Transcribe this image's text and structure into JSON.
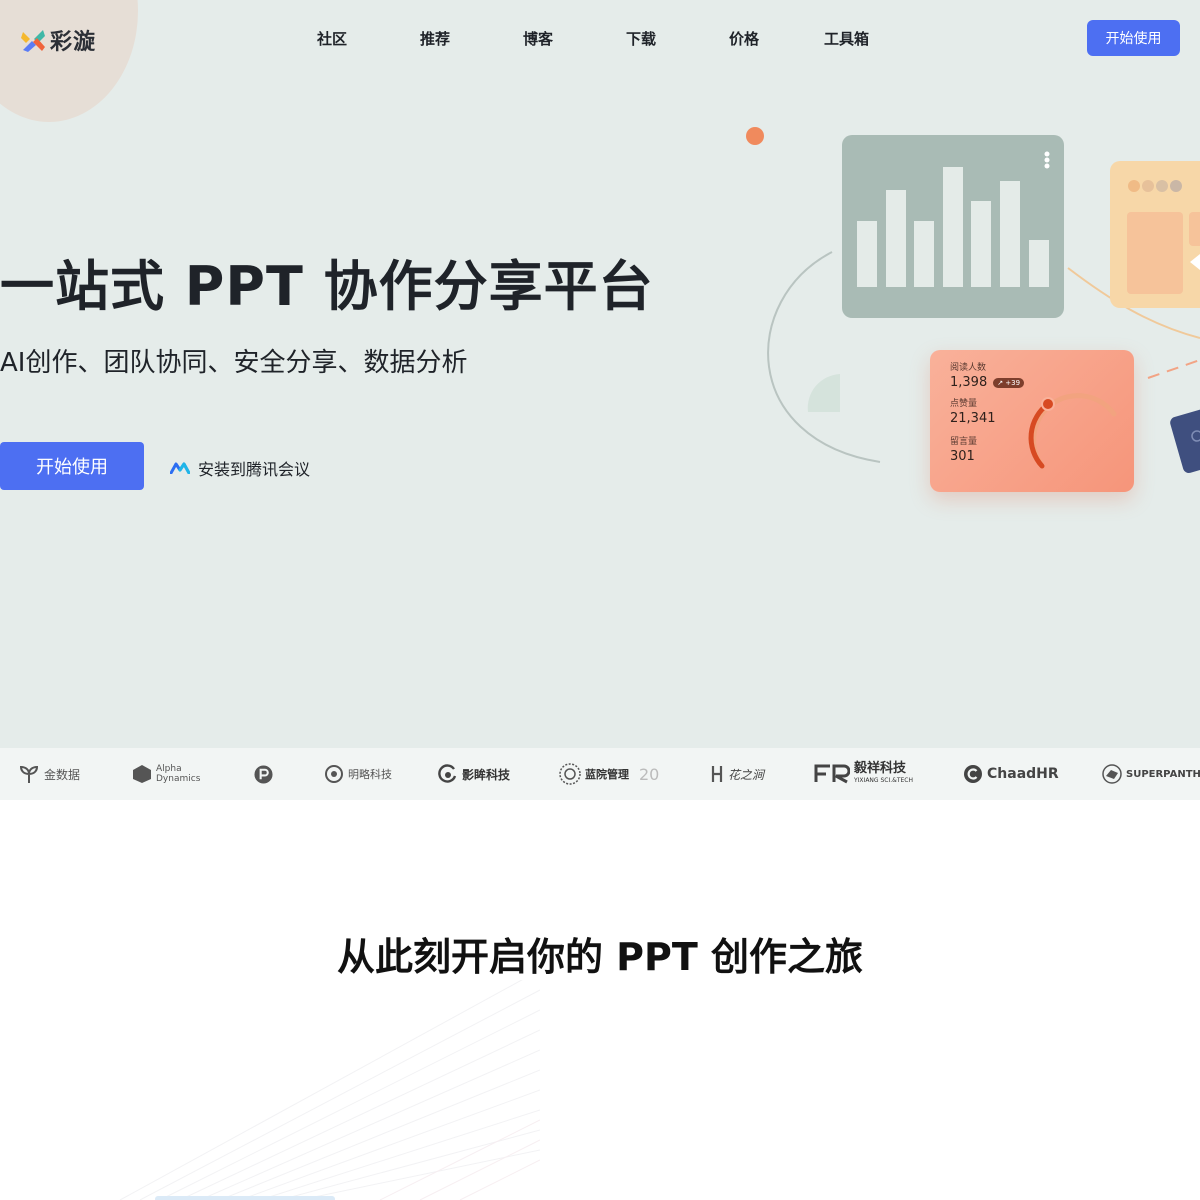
{
  "brand": {
    "name": "彩漩"
  },
  "nav": {
    "items": [
      "社区",
      "推荐",
      "博客",
      "下载",
      "价格",
      "工具箱"
    ]
  },
  "header": {
    "cta_label": "开始使用"
  },
  "hero": {
    "title": "一站式 PPT 协作分享平台",
    "subtitle": "AI创作、团队协同、安全分享、数据分析",
    "cta_label": "开始使用",
    "meeting_link": "安装到腾讯会议"
  },
  "stats_card": {
    "reads_label": "阅读人数",
    "reads_value": "1,398",
    "reads_delta": "↗ +39",
    "likes_label": "点赞量",
    "likes_value": "21,341",
    "comments_label": "留言量",
    "comments_value": "301"
  },
  "partners": [
    "金数据",
    "Alpha Dynamics",
    "明略科技",
    "影眸科技",
    "蓝院管理",
    "20",
    "花之涧",
    "毅祥科技",
    "YIXIANG SCI.&TECH",
    "ChaadHR",
    "SUPERPANTHER"
  ],
  "section": {
    "title": "从此刻开启你的 PPT 创作之旅"
  },
  "colors": {
    "accent": "#4d6ff2",
    "hero_bg": "#e5ecea",
    "stat_card": "#f6957a",
    "chart_card": "#a9bbb5"
  }
}
